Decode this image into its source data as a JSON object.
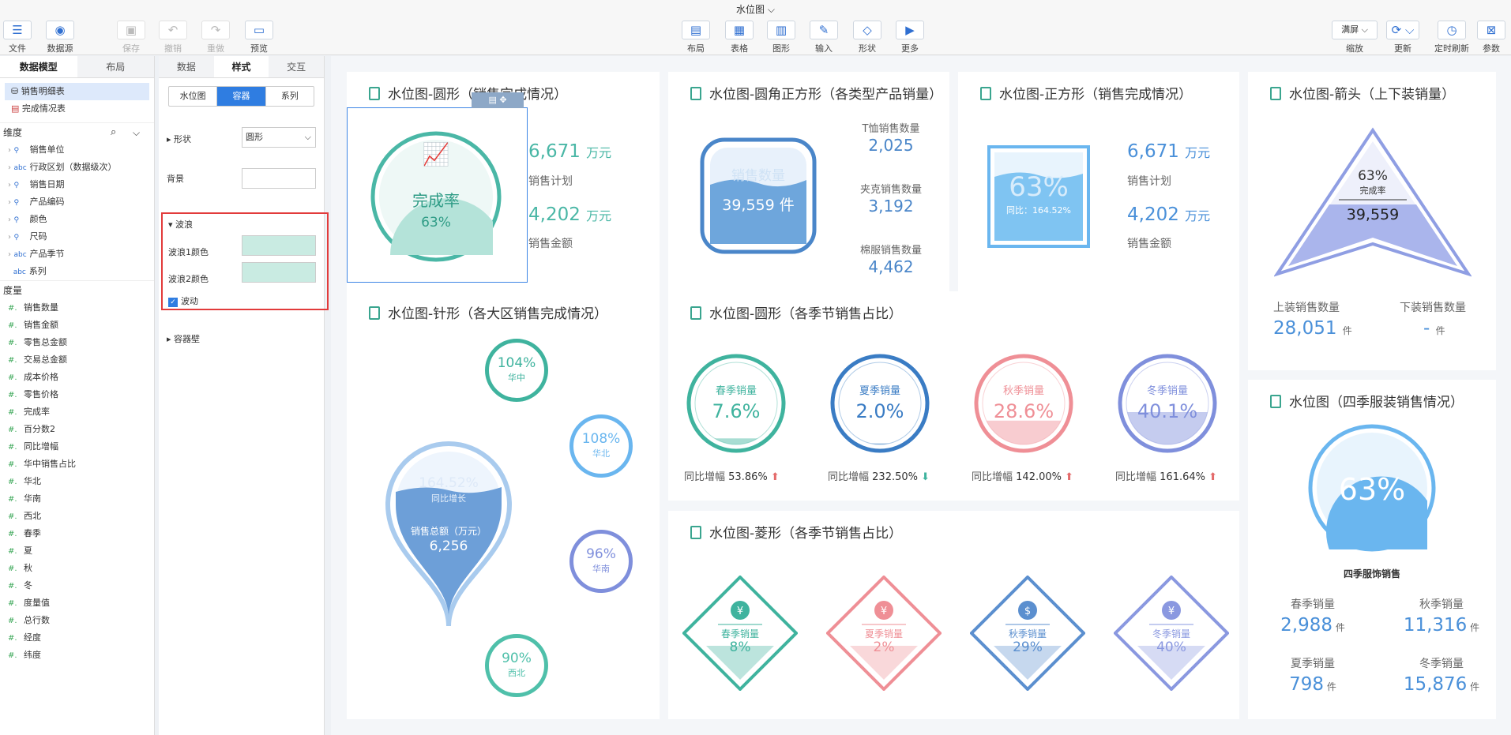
{
  "app": {
    "title": "水位图"
  },
  "toolbar": {
    "file": "文件",
    "datasource": "数据源",
    "save": "保存",
    "undo": "撤销",
    "redo": "重做",
    "preview": "预览",
    "layout": "布局",
    "table": "表格",
    "graph": "图形",
    "input": "输入",
    "shape": "形状",
    "more": "更多",
    "fullscreen": "满屏",
    "zoom": "缩放",
    "refresh": "更新",
    "timed_refresh": "定时刷新",
    "params": "参数"
  },
  "left": {
    "tabs": [
      "数据模型",
      "布局"
    ],
    "tables": [
      "销售明细表",
      "完成情况表"
    ],
    "dim_title": "维度",
    "dims": [
      {
        "icon": "geo",
        "label": "销售单位"
      },
      {
        "icon": "abc",
        "label": "行政区划（数据级次）"
      },
      {
        "icon": "geo",
        "label": "销售日期"
      },
      {
        "icon": "geo",
        "label": "产品编码"
      },
      {
        "icon": "geo",
        "label": "颜色"
      },
      {
        "icon": "geo",
        "label": "尺码"
      },
      {
        "icon": "abc",
        "label": "产品季节"
      },
      {
        "icon": "abc",
        "label": "系列"
      }
    ],
    "mea_title": "度量",
    "measures": [
      "销售数量",
      "销售金额",
      "零售总金额",
      "交易总金额",
      "成本价格",
      "零售价格",
      "完成率",
      "百分数2",
      "同比增幅",
      "华中销售占比",
      "华北",
      "华南",
      "西北",
      "春季",
      "夏",
      "秋",
      "冬",
      "度量值",
      "总行数",
      "经度",
      "纬度"
    ]
  },
  "props": {
    "tabs": [
      "数据",
      "样式",
      "交互"
    ],
    "subtabs": [
      "水位图",
      "容器",
      "系列"
    ],
    "shape_label": "形状",
    "shape_value": "圆形",
    "bg_label": "背景",
    "wave_label": "波浪",
    "wave1_label": "波浪1颜色",
    "wave2_label": "波浪2颜色",
    "flow_label": "波动",
    "wall_label": "容器壁"
  },
  "c1": {
    "title": "水位图-圆形（销售完成情况）",
    "center_label": "完成率",
    "center_value": "63%",
    "v1": "6,671",
    "u1": "万元",
    "l1": "销售计划",
    "v2": "4,202",
    "u2": "万元",
    "l2": "销售金额",
    "progress": 0.63
  },
  "c2": {
    "title": "水位图-圆角正方形（各类型产品销量）",
    "wm": "销售数量",
    "center": "39,559 件",
    "items": [
      {
        "label": "T恤销售数量",
        "value": "2,025"
      },
      {
        "label": "夹克销售数量",
        "value": "3,192"
      },
      {
        "label": "棉服销售数量",
        "value": "4,462"
      }
    ]
  },
  "c3": {
    "title": "水位图-正方形（销售完成情况）",
    "pct": "63%",
    "sub": "同比：164.52%",
    "v1": "6,671",
    "u1": "万元",
    "l1": "销售计划",
    "v2": "4,202",
    "u2": "万元",
    "l2": "销售金额"
  },
  "c4": {
    "title": "水位图-箭头（上下装销量）",
    "pct": "63%",
    "label": "完成率",
    "value": "39,559",
    "l1": "上装销售数量",
    "v1": "28,051",
    "u1": "件",
    "l2": "下装销售数量",
    "v2": "-",
    "u2": "件"
  },
  "c5": {
    "title": "水位图-针形（各大区销售完成情况）",
    "pin_pct": "164.52%",
    "pin_sub": "同比增长",
    "pin_label": "销售总额（万元）",
    "pin_value": "6,256",
    "rings": [
      {
        "pct": "104%",
        "name": "华中"
      },
      {
        "pct": "108%",
        "name": "华北"
      },
      {
        "pct": "96%",
        "name": "华南"
      },
      {
        "pct": "90%",
        "name": "西北"
      }
    ]
  },
  "c6": {
    "title": "水位图-圆形（各季节销售占比）",
    "items": [
      {
        "name": "春季销量",
        "pct": "7.6%",
        "g_label": "同比增幅",
        "g": "53.86%",
        "color": "#3fb39e",
        "level": 0.08
      },
      {
        "name": "夏季销量",
        "pct": "2.0%",
        "g_label": "同比增幅",
        "g": "232.50%",
        "color": "#3a7cc4",
        "level": 0.02
      },
      {
        "name": "秋季销量",
        "pct": "28.6%",
        "g_label": "同比增幅",
        "g": "142.00%",
        "color": "#ef8f96",
        "level": 0.29
      },
      {
        "name": "冬季销量",
        "pct": "40.1%",
        "g_label": "同比增幅",
        "g": "161.64%",
        "color": "#7f8fdc",
        "level": 0.4
      }
    ]
  },
  "c7": {
    "title": "水位图-菱形（各季节销售占比）",
    "items": [
      {
        "name": "春季销量",
        "pct": "8%",
        "color": "#3fb39e"
      },
      {
        "name": "夏季销量",
        "pct": "2%",
        "color": "#ef8f96"
      },
      {
        "name": "秋季销量",
        "pct": "29%",
        "color": "#5b8fcf"
      },
      {
        "name": "冬季销量",
        "pct": "40%",
        "color": "#8a98e0"
      }
    ]
  },
  "c8": {
    "title": "水位图（四季服装销售情况）",
    "pct": "63%",
    "caption": "四季服饰销售",
    "stats": [
      {
        "label": "春季销量",
        "value": "2,988",
        "unit": "件"
      },
      {
        "label": "秋季销量",
        "value": "11,316",
        "unit": "件"
      },
      {
        "label": "夏季销量",
        "value": "798",
        "unit": "件"
      },
      {
        "label": "冬季销量",
        "value": "15,876",
        "unit": "件"
      }
    ]
  }
}
